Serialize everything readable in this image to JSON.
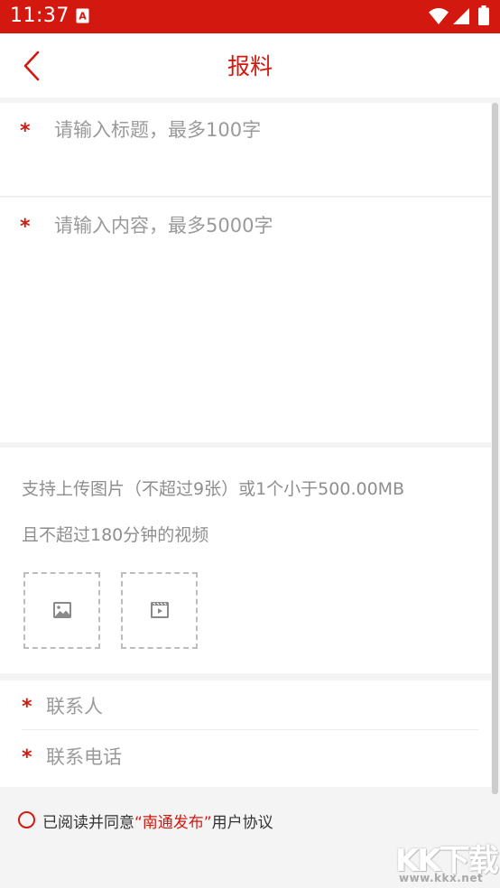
{
  "status_bar": {
    "time": "11:37",
    "notification_icon": "a-letter-notification-icon",
    "wifi_icon": "wifi-icon",
    "signal_icon": "cell-signal-icon",
    "battery_icon": "battery-icon",
    "background": "#d3190f"
  },
  "navbar": {
    "back_icon": "chevron-left-icon",
    "title": "报料"
  },
  "form": {
    "title_field": {
      "required_mark": "*",
      "placeholder": "请输入标题，最多100字",
      "value": ""
    },
    "content_field": {
      "required_mark": "*",
      "placeholder": "请输入内容，最多5000字",
      "value": ""
    },
    "upload": {
      "tip_line1": "支持上传图片（不超过9张）或1个小于500.00MB",
      "tip_line2": "且不超过180分钟的视频",
      "image_button_icon": "image-icon",
      "video_button_icon": "video-icon"
    },
    "contact_name": {
      "required_mark": "*",
      "placeholder": "联系人",
      "value": ""
    },
    "contact_phone": {
      "required_mark": "*",
      "placeholder": "联系电话",
      "value": ""
    }
  },
  "agreement": {
    "prefix": "已阅读并同意",
    "link": "“南通发布”",
    "suffix": "用户协议",
    "checked": false
  },
  "watermark": {
    "logo": "KK下载",
    "url": "www.kkx.net"
  },
  "colors": {
    "accent": "#d3190f",
    "placeholder": "#9a9a9a",
    "background": "#f4f4f4"
  }
}
